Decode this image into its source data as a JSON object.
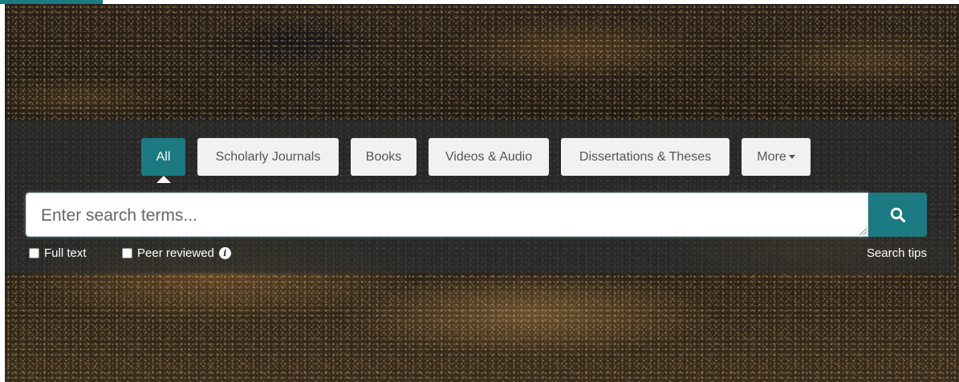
{
  "tabs": [
    {
      "label": "All",
      "active": true
    },
    {
      "label": "Scholarly Journals",
      "active": false
    },
    {
      "label": "Books",
      "active": false
    },
    {
      "label": "Videos & Audio",
      "active": false
    },
    {
      "label": "Dissertations & Theses",
      "active": false
    },
    {
      "label": "More",
      "active": false
    }
  ],
  "search": {
    "placeholder": "Enter search terms...",
    "value": "",
    "button_icon": "search-icon"
  },
  "options": {
    "full_text_label": "Full text",
    "full_text_checked": false,
    "peer_reviewed_label": "Peer reviewed",
    "peer_reviewed_checked": false,
    "info_icon": "info-icon",
    "info_glyph": "i",
    "search_tips_label": "Search tips"
  },
  "colors": {
    "accent": "#1b7a82",
    "tab_bg": "#f1f1f1",
    "tab_text": "#555555"
  }
}
